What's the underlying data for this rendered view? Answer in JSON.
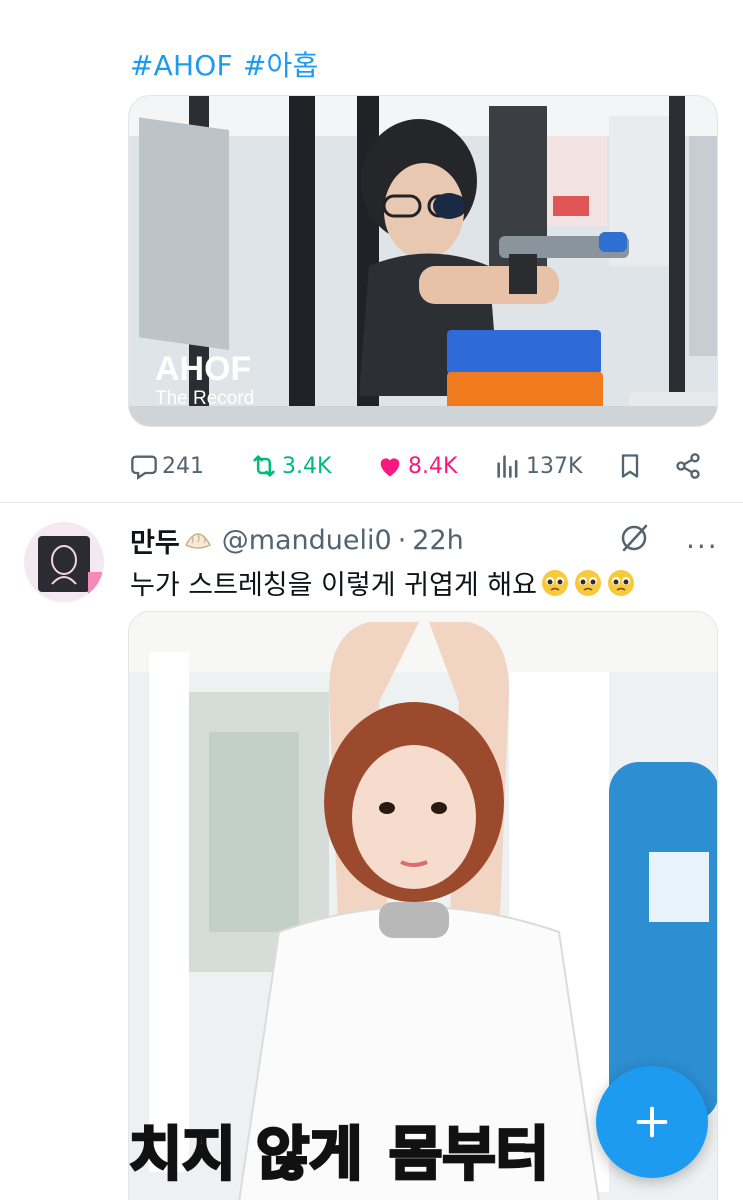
{
  "post1": {
    "hashtags": [
      "#AHOF",
      "#아홉"
    ],
    "media": {
      "logo_text": "AHOF",
      "logo_sub": "The Record"
    },
    "stats": {
      "replies": "241",
      "reposts": "3.4K",
      "likes": "8.4K",
      "views": "137K"
    }
  },
  "post2": {
    "author": {
      "name": "만두",
      "handle": "@mandueli0",
      "time": "22h",
      "separator": "·"
    },
    "text": "누가 스트레칭을 이렇게 귀엽게 해요",
    "media": {
      "caption_part1": "치지 않게",
      "caption_part2": "몸부터"
    }
  },
  "colors": {
    "accent": "#1d9bf0",
    "repost": "#00ba7c",
    "like": "#f91880",
    "muted": "#536471"
  },
  "icons": [
    "reply-icon",
    "repost-icon",
    "like-icon",
    "views-icon",
    "bookmark-icon",
    "share-icon",
    "grok-icon",
    "more-icon",
    "compose-plus-icon"
  ]
}
